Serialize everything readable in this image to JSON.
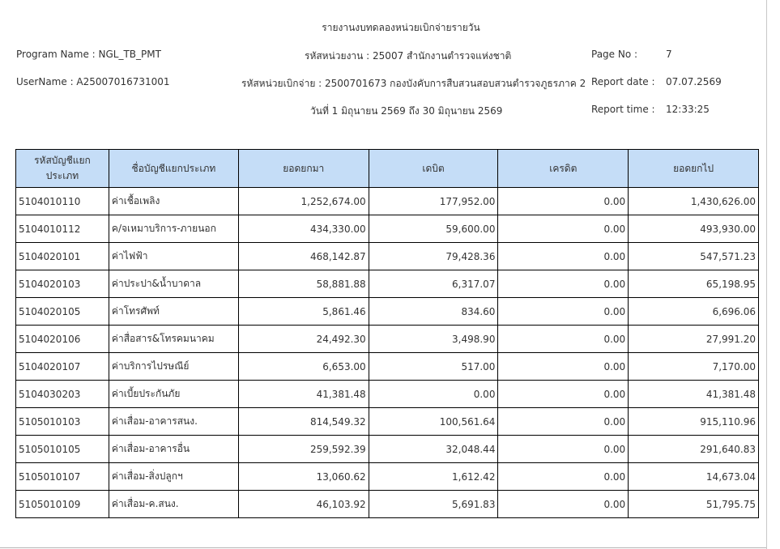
{
  "report": {
    "title": "รายงานงบทดลองหน่วยเบิกจ่ายรายวัน",
    "program_name": "Program Name : NGL_TB_PMT",
    "agency": "รหัสหน่วยงาน : 25007 สำนักงานตำรวจแห่งชาติ",
    "page_label": "Page No :",
    "page_value": "7",
    "user_name": "UserName : A25007016731001",
    "disbursement_unit": "รหัสหน่วยเบิกจ่าย : 2500701673 กองบังคับการสืบสวนสอบสวนตำรวจภูธรภาค 2",
    "report_date_label": "Report date :",
    "report_date_value": "07.07.2569",
    "date_range": "วันที่ 1 มิถุนายน 2569 ถึง 30 มิถุนายน 2569",
    "report_time_label": "Report time :",
    "report_time_value": "12:33:25"
  },
  "table": {
    "headers": [
      "รหัสบัญชีแยกประเภท",
      "ชื่อบัญชีแยกประเภท",
      "ยอดยกมา",
      "เดบิต",
      "เครดิต",
      "ยอดยกไป"
    ],
    "rows": [
      [
        "5104010110",
        "ค่าเชื้อเพลิง",
        "1,252,674.00",
        "177,952.00",
        "0.00",
        "1,430,626.00"
      ],
      [
        "5104010112",
        "ค/จเหมาบริการ-ภายนอก",
        "434,330.00",
        "59,600.00",
        "0.00",
        "493,930.00"
      ],
      [
        "5104020101",
        "ค่าไฟฟ้า",
        "468,142.87",
        "79,428.36",
        "0.00",
        "547,571.23"
      ],
      [
        "5104020103",
        "ค่าประปา&น้ำบาดาล",
        "58,881.88",
        "6,317.07",
        "0.00",
        "65,198.95"
      ],
      [
        "5104020105",
        "ค่าโทรศัพท์",
        "5,861.46",
        "834.60",
        "0.00",
        "6,696.06"
      ],
      [
        "5104020106",
        "ค่าสื่อสาร&โทรคมนาคม",
        "24,492.30",
        "3,498.90",
        "0.00",
        "27,991.20"
      ],
      [
        "5104020107",
        "ค่าบริการไปรษณีย์",
        "6,653.00",
        "517.00",
        "0.00",
        "7,170.00"
      ],
      [
        "5104030203",
        "ค่าเบี้ยประกันภัย",
        "41,381.48",
        "0.00",
        "0.00",
        "41,381.48"
      ],
      [
        "5105010103",
        "ค่าเสื่อม-อาคารสนง.",
        "814,549.32",
        "100,561.64",
        "0.00",
        "915,110.96"
      ],
      [
        "5105010105",
        "ค่าเสื่อม-อาคารอื่น",
        "259,592.39",
        "32,048.44",
        "0.00",
        "291,640.83"
      ],
      [
        "5105010107",
        "ค่าเสื่อม-สิ่งปลูกฯ",
        "13,060.62",
        "1,612.42",
        "0.00",
        "14,673.04"
      ],
      [
        "5105010109",
        "ค่าเสื่อม-ค.สนง.",
        "46,103.92",
        "5,691.83",
        "0.00",
        "51,795.75"
      ]
    ]
  }
}
